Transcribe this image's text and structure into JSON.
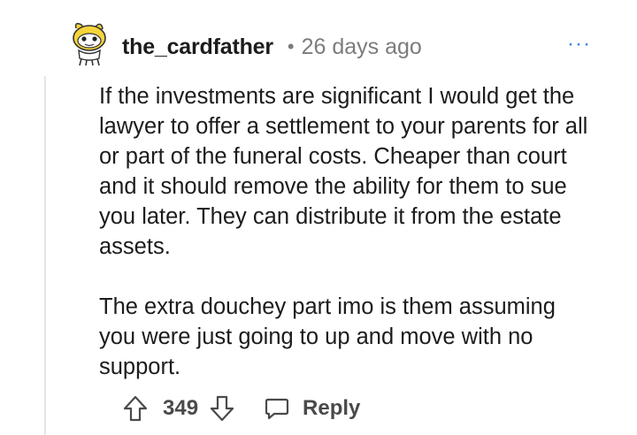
{
  "comment": {
    "username": "the_cardfather",
    "separator": "•",
    "timestamp": "26 days ago",
    "more_menu": "···",
    "avatar_icon": "snoo-avatar-icon",
    "paragraphs": [
      "If the investments are significant I would get the lawyer to offer a settlement to your parents for all or part of the funeral costs. Cheaper than court and it should remove the ability for them to sue you later. They can distribute it from the estate assets.",
      "The extra douchey part imo is them assuming you were just going to up and move with no support."
    ]
  },
  "actions": {
    "upvote_icon": "upvote-arrow-icon",
    "score": "349",
    "downvote_icon": "downvote-arrow-icon",
    "reply_icon": "chat-bubble-icon",
    "reply_label": "Reply"
  },
  "colors": {
    "text": "#1c1c1c",
    "meta": "#7c7c7c",
    "action": "#4a4a4a",
    "more": "#3a8be0",
    "thread_line": "#e5e5e5"
  }
}
